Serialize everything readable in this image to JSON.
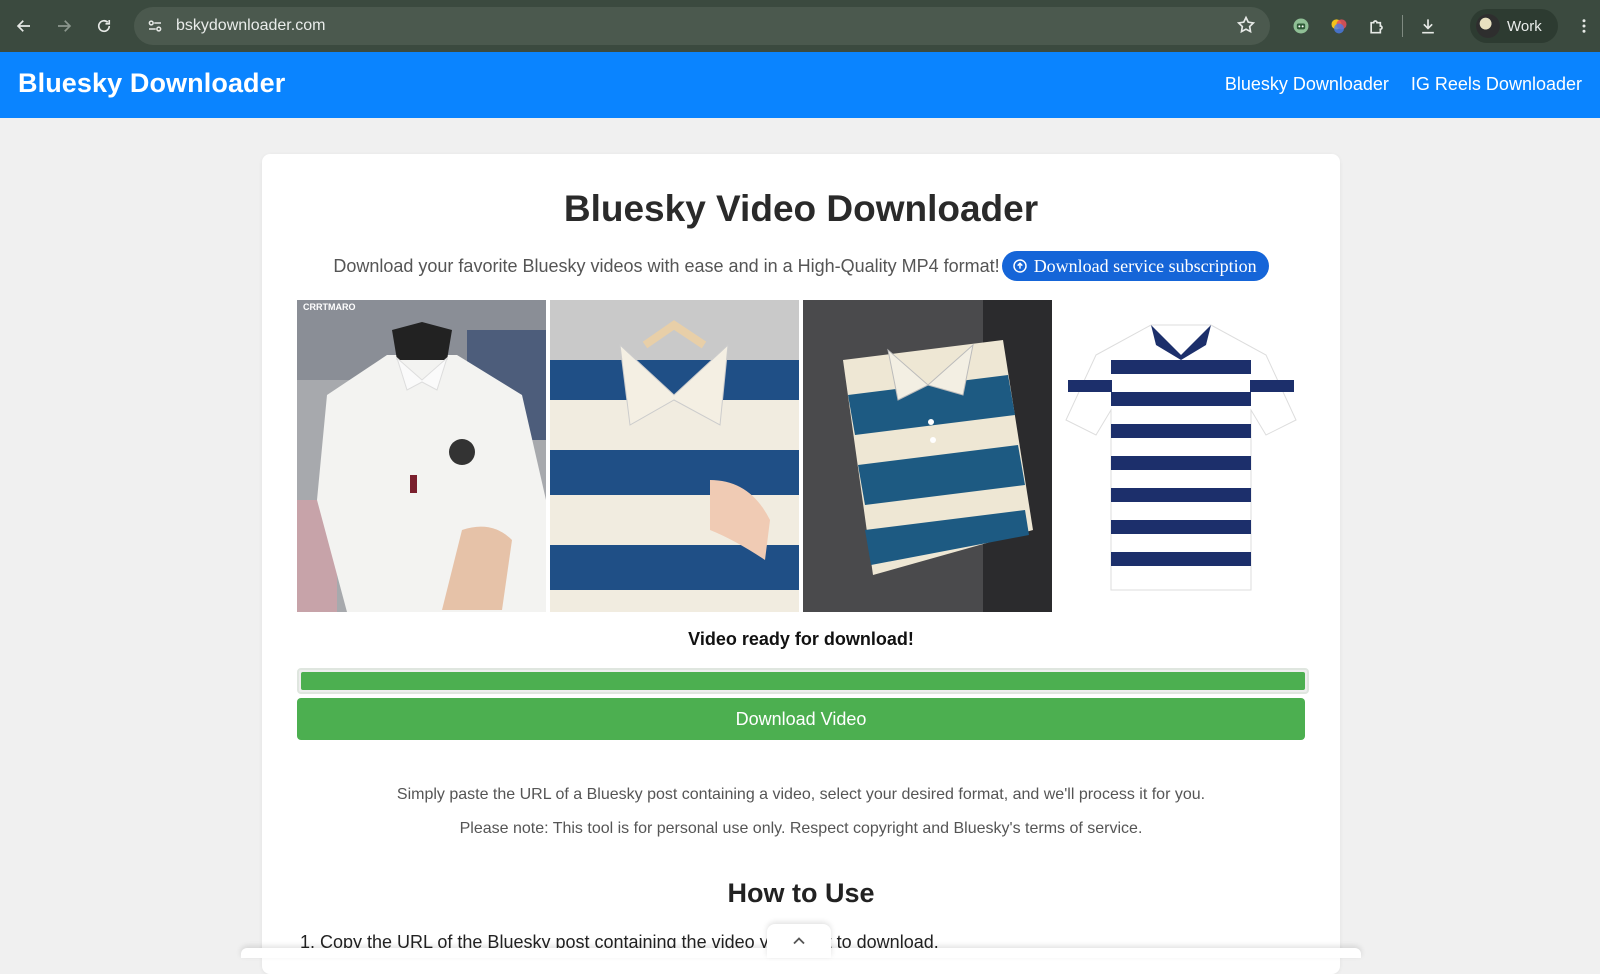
{
  "browser": {
    "url": "bskydownloader.com",
    "profile_label": "Work"
  },
  "site": {
    "brand": "Bluesky Downloader",
    "nav": [
      {
        "label": "Bluesky Downloader"
      },
      {
        "label": "IG Reels Downloader"
      }
    ],
    "accent_color": "#0a84ff"
  },
  "main": {
    "title": "Bluesky Video Downloader",
    "subtitle": "Download your favorite Bluesky videos with ease and in a High-Quality MP4 format!",
    "subscription_button": "Download service subscription",
    "thumbnails": [
      {
        "logo_text": "CRRTMARO"
      },
      {
        "logo_text": ""
      },
      {
        "logo_text": ""
      },
      {
        "logo_text": ""
      }
    ],
    "status": "Video ready for download!",
    "progress_percent": 100,
    "download_button": "Download Video",
    "success_color": "#4caf50",
    "info_line_1": "Simply paste the URL of a Bluesky post containing a video, select your desired format, and we'll process it for you.",
    "info_line_2": "Please note: This tool is for personal use only. Respect copyright and Bluesky's terms of service.",
    "how_to_title": "How to Use",
    "steps": [
      {
        "text": "1. Copy the URL of the Bluesky post containing the video you want to download."
      }
    ]
  }
}
